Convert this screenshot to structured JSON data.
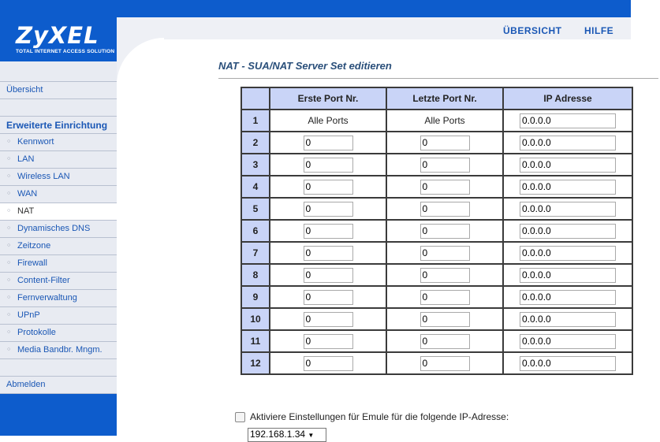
{
  "brand": {
    "name": "ZyXEL",
    "tagline": "TOTAL INTERNET ACCESS SOLUTION"
  },
  "header": {
    "overview": "ÜBERSICHT",
    "help": "HILFE"
  },
  "sidebar": {
    "overview": "Übersicht",
    "section_title": "Erweiterte Einrichtung",
    "items": [
      "Kennwort",
      "LAN",
      "Wireless LAN",
      "WAN",
      "NAT",
      "Dynamisches DNS",
      "Zeitzone",
      "Firewall",
      "Content-Filter",
      "Fernverwaltung",
      "UPnP",
      "Protokolle",
      "Media Bandbr. Mngm."
    ],
    "logout": "Abmelden"
  },
  "main": {
    "title": "NAT - SUA/NAT Server Set editieren",
    "columns": [
      "Erste Port Nr.",
      "Letzte Port Nr.",
      "IP Adresse"
    ],
    "rows": [
      {
        "nr": "1",
        "first": "Alle Ports",
        "last": "Alle Ports",
        "ip": "0.0.0.0"
      },
      {
        "nr": "2",
        "first": "0",
        "last": "0",
        "ip": "0.0.0.0"
      },
      {
        "nr": "3",
        "first": "0",
        "last": "0",
        "ip": "0.0.0.0"
      },
      {
        "nr": "4",
        "first": "0",
        "last": "0",
        "ip": "0.0.0.0"
      },
      {
        "nr": "5",
        "first": "0",
        "last": "0",
        "ip": "0.0.0.0"
      },
      {
        "nr": "6",
        "first": "0",
        "last": "0",
        "ip": "0.0.0.0"
      },
      {
        "nr": "7",
        "first": "0",
        "last": "0",
        "ip": "0.0.0.0"
      },
      {
        "nr": "8",
        "first": "0",
        "last": "0",
        "ip": "0.0.0.0"
      },
      {
        "nr": "9",
        "first": "0",
        "last": "0",
        "ip": "0.0.0.0"
      },
      {
        "nr": "10",
        "first": "0",
        "last": "0",
        "ip": "0.0.0.0"
      },
      {
        "nr": "11",
        "first": "0",
        "last": "0",
        "ip": "0.0.0.0"
      },
      {
        "nr": "12",
        "first": "0",
        "last": "0",
        "ip": "0.0.0.0"
      }
    ],
    "emule_label": "Aktiviere Einstellungen für Emule für die folgende IP-Adresse:",
    "emule_ip": "192.168.1.34"
  },
  "colors": {
    "brand_blue": "#0d5ccc",
    "header_bg": "#c9d4f7",
    "link": "#1a57b5"
  }
}
